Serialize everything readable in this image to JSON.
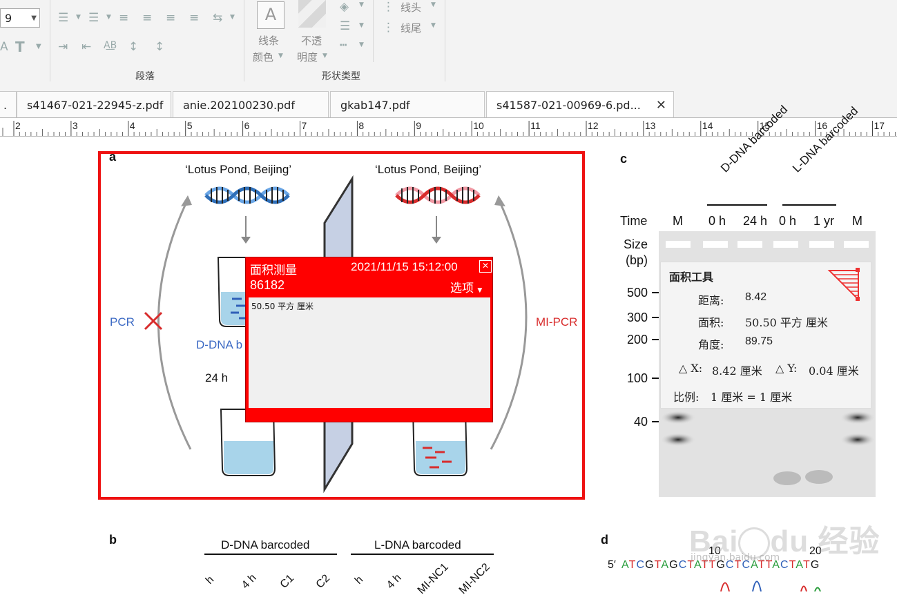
{
  "ribbon": {
    "font_size": "9",
    "line_color_label_1": "线条",
    "line_color_label_2": "颜色",
    "opacity_label_1": "不透",
    "opacity_label_2": "明度",
    "line_head_label": "线头",
    "line_tail_label": "线尾",
    "group_paragraph": "段落",
    "group_shape_type": "形状类型"
  },
  "tabs": [
    {
      "label": "."
    },
    {
      "label": "s41467-021-22945-z.pdf"
    },
    {
      "label": "anie.202100230.pdf"
    },
    {
      "label": "gkab147.pdf"
    },
    {
      "label": "s41587-021-00969-6.pd...",
      "close": "✕"
    }
  ],
  "ruler": {
    "numbers": [
      "2",
      "3",
      "4",
      "5",
      "6",
      "7",
      "8",
      "9",
      "10",
      "11",
      "12",
      "13",
      "14",
      "15",
      "16",
      "17"
    ]
  },
  "figure": {
    "panel_a_label": "a",
    "lotus_left": "‘Lotus Pond, Beijing’",
    "lotus_right": "‘Lotus Pond, Beijing’",
    "pcr": "PCR",
    "mi_pcr": "MI-PCR",
    "ddna_label": "D-DNA b",
    "time_24h": "24 h",
    "panel_b_label": "b",
    "b_ddna": "D-DNA barcoded",
    "b_ldna": "L-DNA barcoded",
    "b_cols": [
      "h",
      "4 h",
      "C1",
      "C2",
      "h",
      "4 h",
      "MI-NC1",
      "MI-NC2"
    ],
    "panel_c_label": "c",
    "c_ddna": "D-DNA barcoded",
    "c_ldna": "L-DNA barcoded",
    "c_time": "Time",
    "c_lanes": [
      "M",
      "0 h",
      "24 h",
      "0 h",
      "1 yr",
      "M"
    ],
    "c_size": "Size",
    "c_bp": "(bp)",
    "c_sizes": [
      "500",
      "300",
      "200",
      "100",
      "40"
    ],
    "panel_d_label": "d",
    "d_seq_prefix": "5′",
    "d_seq": "ATCGTAGCTATTGCTCATTACTATG",
    "d_tick_10": "10",
    "d_tick_20": "20",
    "watermark_text": "jingyan.baidu.com"
  },
  "measure_popup": {
    "title": "面积测量",
    "datetime": "2021/11/15 15:12:00",
    "number": "86182",
    "options": "选项",
    "content": "50.50 平方 厘米"
  },
  "area_tool": {
    "title": "面积工具",
    "distance_label": "距离:",
    "distance_value": "8.42",
    "area_label": "面积:",
    "area_value": "50.50 平方 厘米",
    "angle_label": "角度:",
    "angle_value": "89.75",
    "dx_label": "△ X:",
    "dx_value": "8.42 厘米",
    "dy_label": "△ Y:",
    "dy_value": "0.04 厘米",
    "scale_label": "比例:",
    "scale_value": "1 厘米 = 1 厘米"
  },
  "colors": {
    "highlight_border": "#e11111",
    "popup_red": "#ff0000",
    "dna_blue": "#4a8fd8",
    "dna_red": "#d82c2c"
  }
}
